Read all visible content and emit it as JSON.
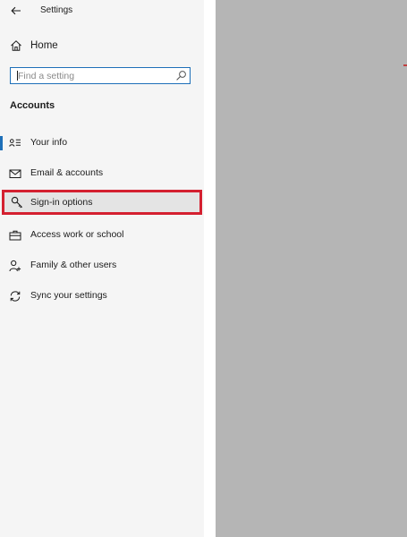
{
  "window": {
    "title": "Settings"
  },
  "nav": {
    "home": {
      "label": "Home",
      "icon": "home-icon"
    },
    "search": {
      "placeholder": "Find a setting",
      "icon": "search-icon"
    },
    "section_heading": "Accounts",
    "items": [
      {
        "label": "Your info",
        "icon": "person-card-icon",
        "selected": true
      },
      {
        "label": "Email & accounts",
        "icon": "envelope-icon",
        "selected": false
      },
      {
        "label": "Sign-in options",
        "icon": "key-icon",
        "selected": false,
        "highlighted": true
      },
      {
        "label": "Access work or school",
        "icon": "briefcase-icon",
        "selected": false
      },
      {
        "label": "Family & other users",
        "icon": "person-add-icon",
        "selected": false
      },
      {
        "label": "Sync your settings",
        "icon": "sync-icon",
        "selected": false
      }
    ]
  },
  "colors": {
    "accent": "#1e6fb8",
    "highlight_border": "#d42030",
    "content_pane": "#b5b5b5"
  }
}
